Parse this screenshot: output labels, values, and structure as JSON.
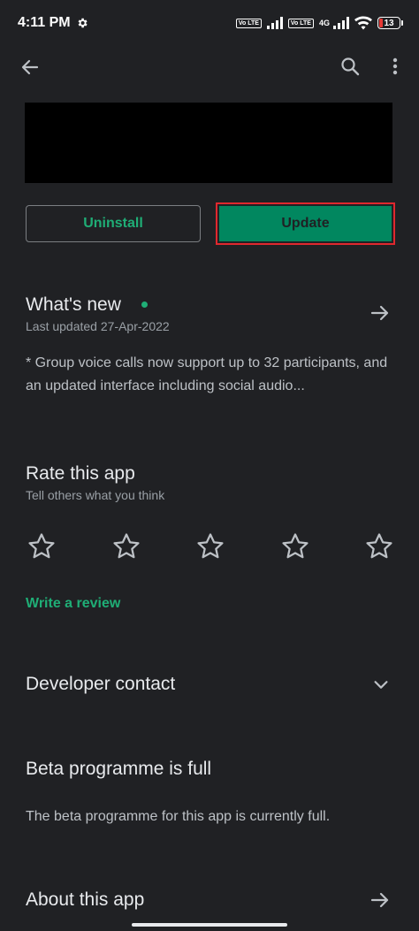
{
  "status_bar": {
    "time": "4:11 PM",
    "volte1": "Vo LTE",
    "volte2": "Vo LTE",
    "network": "4G",
    "battery": "13"
  },
  "icons": {
    "back": "back-arrow-icon",
    "search": "search-icon",
    "more": "more-vert-icon"
  },
  "buttons": {
    "uninstall": "Uninstall",
    "update": "Update"
  },
  "whats_new": {
    "title": "What's new",
    "subtitle": "Last updated 27-Apr-2022",
    "body": "* Group voice calls now support up to 32 participants, and an updated interface including social audio..."
  },
  "rate": {
    "title": "Rate this app",
    "subtitle": "Tell others what you think",
    "star_count": 5,
    "write_review": "Write a review"
  },
  "developer_contact": {
    "title": "Developer contact"
  },
  "beta": {
    "title": "Beta programme is full",
    "body": "The beta programme for this app is currently full."
  },
  "about": {
    "title": "About this app"
  },
  "colors": {
    "background": "#202124",
    "accent_green": "#01875f",
    "link_green": "#1fae76",
    "highlight_red": "#e0282e"
  }
}
